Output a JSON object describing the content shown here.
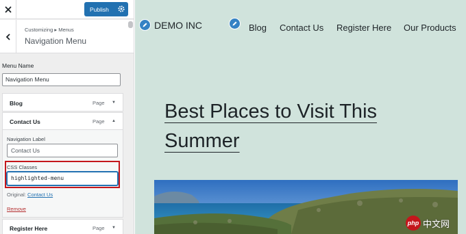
{
  "customizer": {
    "publish_label": "Publish",
    "breadcrumb": "Customizing ▸ Menus",
    "section_title": "Navigation Menu",
    "menu_name_label": "Menu Name",
    "menu_name_value": "Navigation Menu",
    "items": [
      {
        "title": "Blog",
        "type": "Page"
      },
      {
        "title": "Contact Us",
        "type": "Page"
      },
      {
        "title": "Register Here",
        "type": "Page"
      }
    ],
    "expanded": {
      "nav_label_label": "Navigation Label",
      "nav_label_placeholder": "Contact Us",
      "css_classes_label": "CSS Classes",
      "css_classes_value": "highlighted-menu",
      "original_label": "Original:",
      "original_link": "Contact Us",
      "remove_label": "Remove"
    }
  },
  "preview": {
    "site_title": "DEMO INC",
    "nav_links": [
      "Blog",
      "Contact Us",
      "Register Here",
      "Our Products"
    ],
    "post_title": "Best Places to Visit This Summer",
    "watermark": {
      "badge": "php",
      "text": "中文网"
    }
  },
  "colors": {
    "accent": "#2271b1",
    "highlight_box": "#c4161c",
    "preview_bg": "#d0e3dc"
  }
}
